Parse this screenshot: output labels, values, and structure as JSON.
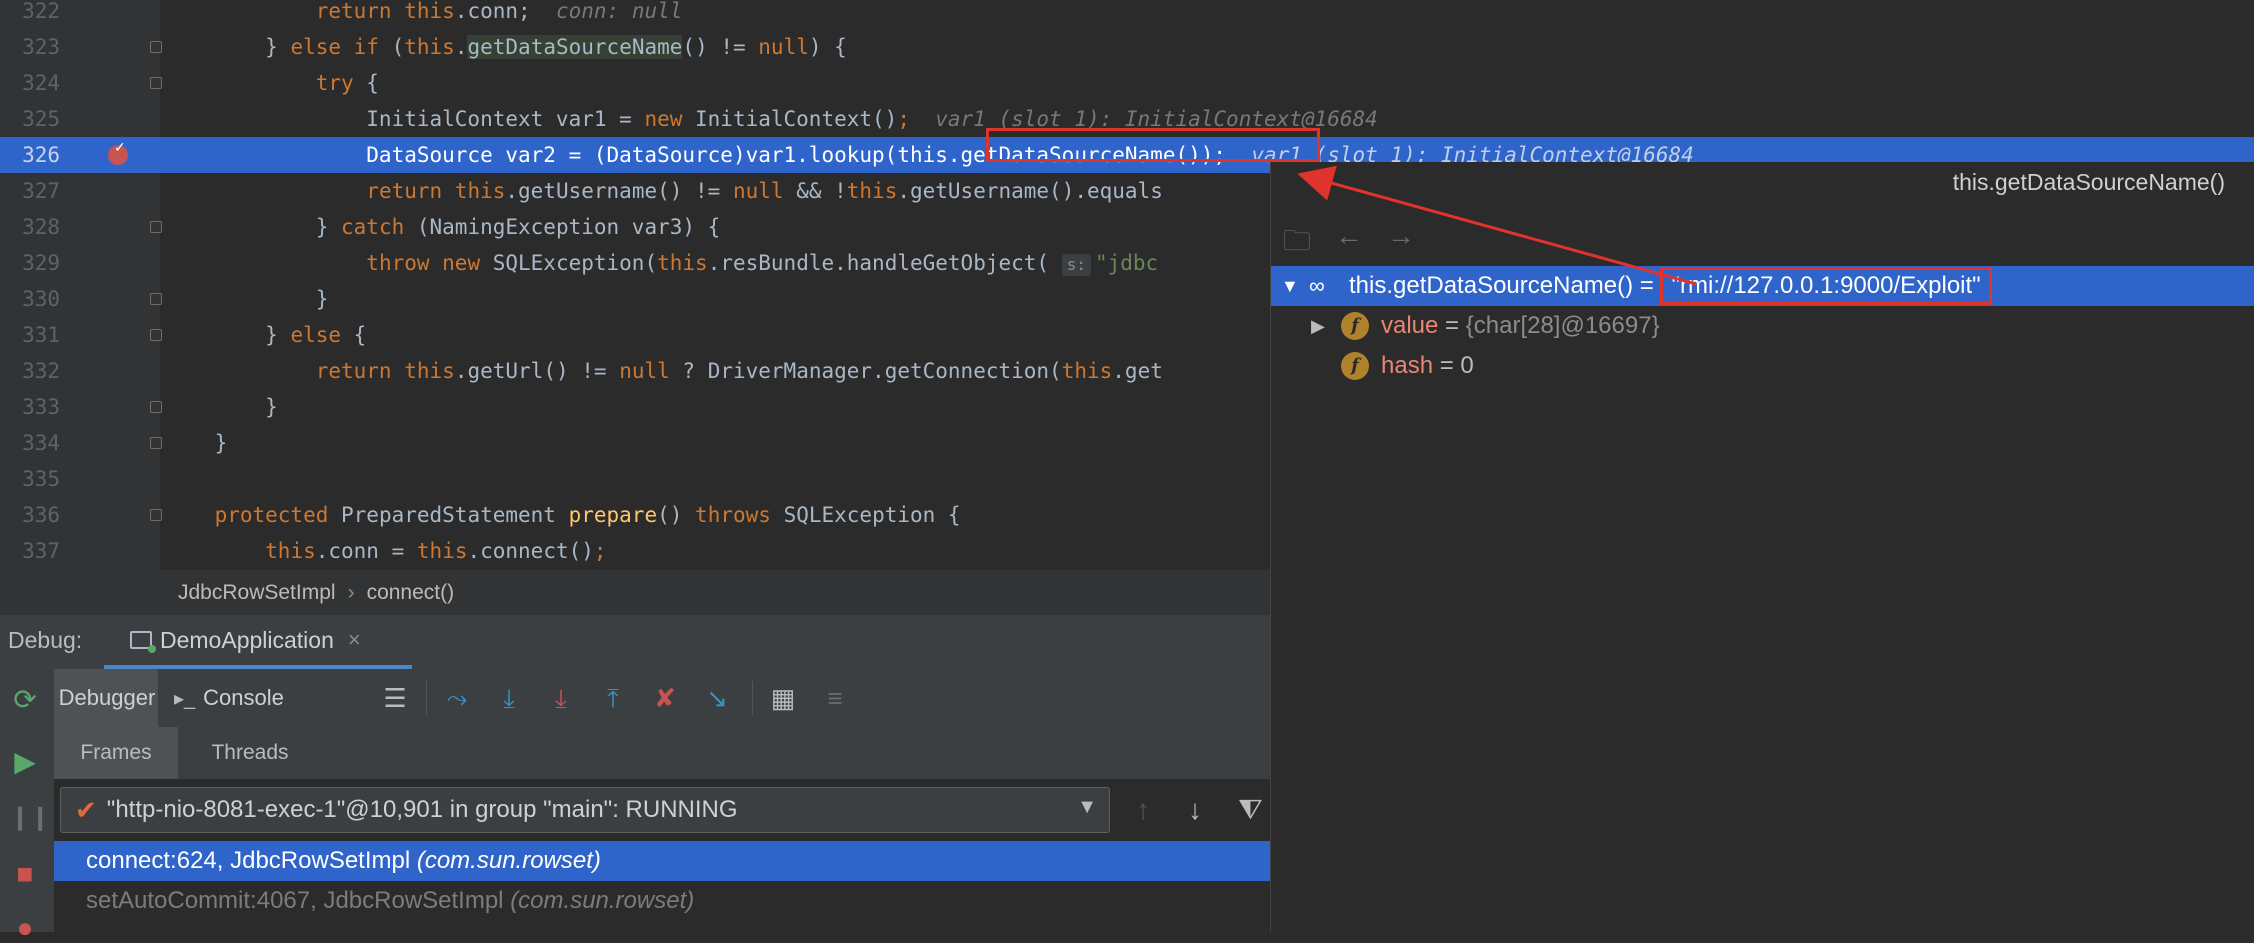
{
  "editor": {
    "lines": [
      {
        "num": "322",
        "segments": [
          {
            "t": "            "
          },
          {
            "t": "return ",
            "c": "kw"
          },
          {
            "t": "this",
            "c": "kw"
          },
          {
            "t": ".conn;  "
          },
          {
            "t": "conn: null",
            "c": "hint"
          }
        ]
      },
      {
        "num": "323",
        "segments": [
          {
            "t": "        } "
          },
          {
            "t": "else if ",
            "c": "kw"
          },
          {
            "t": "("
          },
          {
            "t": "this",
            "c": "kw"
          },
          {
            "t": "."
          },
          {
            "t": "getDataSourceName",
            "c": "hl"
          },
          {
            "t": "() != "
          },
          {
            "t": "null",
            "c": "kw"
          },
          {
            "t": ") {"
          }
        ]
      },
      {
        "num": "324",
        "segments": [
          {
            "t": "            "
          },
          {
            "t": "try ",
            "c": "kw"
          },
          {
            "t": "{"
          }
        ]
      },
      {
        "num": "325",
        "segments": [
          {
            "t": "                InitialContext var1 = "
          },
          {
            "t": "new ",
            "c": "kw"
          },
          {
            "t": "InitialContext()"
          },
          {
            "t": ";",
            "c": "kw"
          },
          {
            "t": "  var1 (slot_1): InitialContext@16684",
            "c": "hint"
          }
        ]
      },
      {
        "num": "326",
        "segments": [
          {
            "t": "                DataSource var2 = (DataSource)var1.lookup("
          },
          {
            "t": "this",
            "c": "kw"
          },
          {
            "t": ".getDataSourceName());"
          },
          {
            "t": "  var1 (slot_1): InitialContext@16684",
            "c": "hint"
          }
        ]
      },
      {
        "num": "327",
        "segments": [
          {
            "t": "                "
          },
          {
            "t": "return ",
            "c": "kw"
          },
          {
            "t": "this",
            "c": "kw"
          },
          {
            "t": ".getUsername() != "
          },
          {
            "t": "null ",
            "c": "kw"
          },
          {
            "t": "&& !"
          },
          {
            "t": "this",
            "c": "kw"
          },
          {
            "t": ".getUsername().equals"
          }
        ]
      },
      {
        "num": "328",
        "segments": [
          {
            "t": "            } "
          },
          {
            "t": "catch ",
            "c": "kw"
          },
          {
            "t": "(NamingException var3) {"
          }
        ]
      },
      {
        "num": "329",
        "segments": [
          {
            "t": "                "
          },
          {
            "t": "throw new ",
            "c": "kw"
          },
          {
            "t": "SQLException("
          },
          {
            "t": "this",
            "c": "kw"
          },
          {
            "t": ".resBundle.handleGetObject( "
          },
          {
            "t": "s:",
            "c": "ptag"
          },
          {
            "t": "\"jdbc",
            "c": "str"
          }
        ]
      },
      {
        "num": "330",
        "segments": [
          {
            "t": "            }"
          }
        ]
      },
      {
        "num": "331",
        "segments": [
          {
            "t": "        } "
          },
          {
            "t": "else ",
            "c": "kw"
          },
          {
            "t": "{"
          }
        ]
      },
      {
        "num": "332",
        "segments": [
          {
            "t": "            "
          },
          {
            "t": "return ",
            "c": "kw"
          },
          {
            "t": "this",
            "c": "kw"
          },
          {
            "t": ".getUrl() != "
          },
          {
            "t": "null ",
            "c": "kw"
          },
          {
            "t": "? DriverManager.getConnection("
          },
          {
            "t": "this",
            "c": "kw"
          },
          {
            "t": ".get"
          }
        ]
      },
      {
        "num": "333",
        "segments": [
          {
            "t": "        }"
          }
        ]
      },
      {
        "num": "334",
        "segments": [
          {
            "t": "    }"
          }
        ]
      },
      {
        "num": "335",
        "segments": [
          {
            "t": ""
          }
        ]
      },
      {
        "num": "336",
        "segments": [
          {
            "t": "    "
          },
          {
            "t": "protected ",
            "c": "kw"
          },
          {
            "t": "PreparedStatement "
          },
          {
            "t": "prepare",
            "c": "fn"
          },
          {
            "t": "() "
          },
          {
            "t": "throws ",
            "c": "kw"
          },
          {
            "t": "SQLException {"
          }
        ]
      },
      {
        "num": "337",
        "segments": [
          {
            "t": "        "
          },
          {
            "t": "this",
            "c": "kw"
          },
          {
            "t": ".conn = "
          },
          {
            "t": "this",
            "c": "kw"
          },
          {
            "t": ".connect()"
          },
          {
            "t": ";",
            "c": "kw"
          }
        ]
      }
    ]
  },
  "breadcrumb": {
    "class_name": "JdbcRowSetImpl",
    "separator": "›",
    "method": "connect()"
  },
  "debug": {
    "label": "Debug:",
    "config_tab": "DemoApplication",
    "close": "×",
    "tabs": {
      "debugger": "Debugger",
      "console": "Console"
    },
    "frames_tabs": {
      "frames": "Frames",
      "threads": "Threads"
    },
    "thread": "\"http-nio-8081-exec-1\"@10,901 in group \"main\": RUNNING",
    "frames": [
      {
        "method": "connect:624, JdbcRowSetImpl ",
        "pkg": "(com.sun.rowset)"
      },
      {
        "method": "setAutoCommit:4067, JdbcRowSetImpl ",
        "pkg": "(com.sun.rowset)"
      }
    ]
  },
  "popup": {
    "title": "this.getDataSourceName()",
    "root": {
      "expr": "this.getDataSourceName()",
      "eq": " = ",
      "value": "\"rmi://127.0.0.1:9000/Exploit\""
    },
    "fields": [
      {
        "name": "value",
        "eq": " = ",
        "value": "{char[28]@16697}"
      },
      {
        "name": "hash",
        "eq": " = ",
        "value": "0"
      }
    ]
  },
  "colors": {
    "accent": "#2f65ca",
    "annotation": "#e0332d",
    "keyword": "#cc7832"
  }
}
